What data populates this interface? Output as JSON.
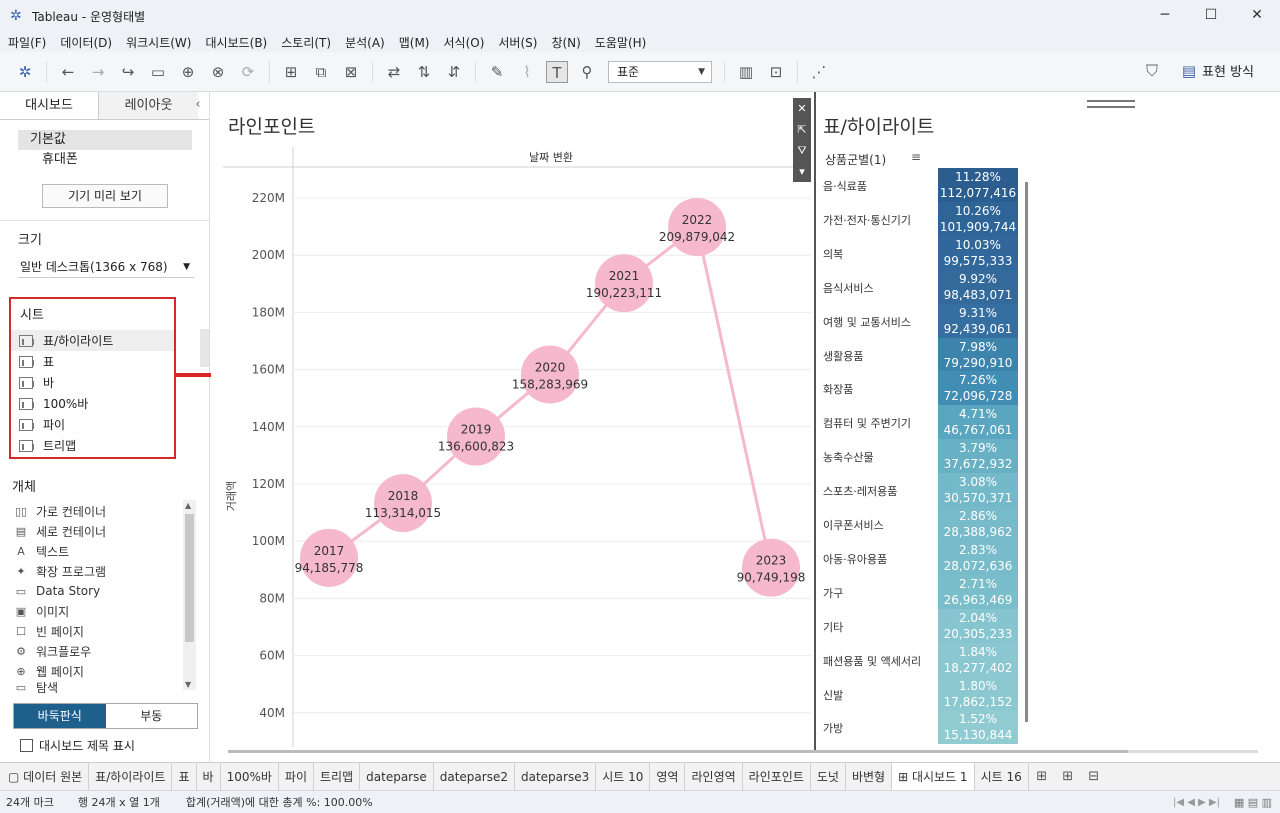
{
  "window": {
    "title": "Tableau - 운영형태별"
  },
  "menu": [
    "파일(F)",
    "데이터(D)",
    "워크시트(W)",
    "대시보드(B)",
    "스토리(T)",
    "분석(A)",
    "맵(M)",
    "서식(O)",
    "서버(S)",
    "창(N)",
    "도움말(H)"
  ],
  "toolbar": {
    "fit_value": "표준",
    "present_label": "표현 방식"
  },
  "left": {
    "tab_dashboard": "대시보드",
    "tab_layout": "레이아웃",
    "device_default": "기본값",
    "device_phone": "휴대폰",
    "device_preview": "기기 미리 보기",
    "size_title": "크기",
    "size_value": "일반 데스크톱(1366 x 768)",
    "sheets_title": "시트",
    "sheets": [
      "표/하이라이트",
      "표",
      "바",
      "100%바",
      "파이",
      "트리맵"
    ],
    "objects_title": "개체",
    "objects": [
      {
        "icon": "horizontal-container-icon",
        "glyph": "▯▯",
        "label": "가로 컨테이너"
      },
      {
        "icon": "vertical-container-icon",
        "glyph": "▤",
        "label": "세로 컨테이너"
      },
      {
        "icon": "text-icon",
        "glyph": "A",
        "label": "텍스트"
      },
      {
        "icon": "extension-icon",
        "glyph": "✦",
        "label": "확장 프로그램"
      },
      {
        "icon": "data-story-icon",
        "glyph": "▭",
        "label": "Data Story"
      },
      {
        "icon": "image-icon",
        "glyph": "▣",
        "label": "이미지"
      },
      {
        "icon": "blank-page-icon",
        "glyph": "☐",
        "label": "빈 페이지"
      },
      {
        "icon": "workflow-icon",
        "glyph": "⚙",
        "label": "워크플로우"
      },
      {
        "icon": "web-page-icon",
        "glyph": "⊕",
        "label": "웹 페이지"
      },
      {
        "icon": "navigation-icon",
        "glyph": "▭",
        "label": "탐색"
      }
    ],
    "layout_tiled": "바둑판식",
    "layout_floating": "부동",
    "show_title": "대시보드 제목 표시"
  },
  "chart": {
    "title": "라인포인트",
    "column_header": "날짜 변환",
    "ylabel": "거래액"
  },
  "chart_data": {
    "type": "line",
    "x": [
      "2017",
      "2018",
      "2019",
      "2020",
      "2021",
      "2022",
      "2023"
    ],
    "values": [
      94185778,
      113314015,
      136600823,
      158283969,
      190223111,
      209879042,
      90749198
    ],
    "labels": [
      "94,185,778",
      "113,314,015",
      "136,600,823",
      "158,283,969",
      "190,223,111",
      "209,879,042",
      "90,749,198"
    ],
    "ylim": [
      40000000,
      220000000
    ],
    "yticks": [
      {
        "v": 220000000,
        "label": "220M"
      },
      {
        "v": 200000000,
        "label": "200M"
      },
      {
        "v": 180000000,
        "label": "180M"
      },
      {
        "v": 160000000,
        "label": "160M"
      },
      {
        "v": 140000000,
        "label": "140M"
      },
      {
        "v": 120000000,
        "label": "120M"
      },
      {
        "v": 100000000,
        "label": "100M"
      },
      {
        "v": 80000000,
        "label": "80M"
      },
      {
        "v": 60000000,
        "label": "60M"
      },
      {
        "v": 40000000,
        "label": "40M"
      }
    ],
    "color": "#f5b8cc"
  },
  "highlight": {
    "title": "표/하이라이트",
    "header": "상품군별(1)",
    "rows": [
      {
        "cat": "음·식료품",
        "pct": "11.28%",
        "val": "112,077,416",
        "color": "#2c5d8f"
      },
      {
        "cat": "가전·전자·통신기기",
        "pct": "10.26%",
        "val": "101,909,744",
        "color": "#2f6496"
      },
      {
        "cat": "의복",
        "pct": "10.03%",
        "val": "99,575,333",
        "color": "#31679a"
      },
      {
        "cat": "음식서비스",
        "pct": "9.92%",
        "val": "98,483,071",
        "color": "#33699b"
      },
      {
        "cat": "여행 및 교통서비스",
        "pct": "9.31%",
        "val": "92,439,061",
        "color": "#356ea0"
      },
      {
        "cat": "생활용품",
        "pct": "7.98%",
        "val": "79,290,910",
        "color": "#3d84ad"
      },
      {
        "cat": "화장품",
        "pct": "7.26%",
        "val": "72,096,728",
        "color": "#418db3"
      },
      {
        "cat": "컴퓨터 및 주변기기",
        "pct": "4.71%",
        "val": "46,767,061",
        "color": "#5aa6c0"
      },
      {
        "cat": "농축수산물",
        "pct": "3.79%",
        "val": "37,672,932",
        "color": "#68b1c5"
      },
      {
        "cat": "스포츠·레저용품",
        "pct": "3.08%",
        "val": "30,570,371",
        "color": "#73b9c9"
      },
      {
        "cat": "이쿠폰서비스",
        "pct": "2.86%",
        "val": "28,388,962",
        "color": "#77bbca"
      },
      {
        "cat": "아동·유아용품",
        "pct": "2.83%",
        "val": "28,072,636",
        "color": "#78bccb"
      },
      {
        "cat": "가구",
        "pct": "2.71%",
        "val": "26,963,469",
        "color": "#7abdcb"
      },
      {
        "cat": "기타",
        "pct": "2.04%",
        "val": "20,305,233",
        "color": "#86c5cf"
      },
      {
        "cat": "패션용품 및 액세서리",
        "pct": "1.84%",
        "val": "18,277,402",
        "color": "#8ac7d0"
      },
      {
        "cat": "신발",
        "pct": "1.80%",
        "val": "17,862,152",
        "color": "#8bc8d0"
      },
      {
        "cat": "가방",
        "pct": "1.52%",
        "val": "15,130,844",
        "color": "#90cbd2"
      }
    ]
  },
  "tabs": {
    "datasource": "데이터 원본",
    "items": [
      "표/하이라이트",
      "표",
      "바",
      "100%바",
      "파이",
      "트리맵",
      "dateparse",
      "dateparse2",
      "dateparse3",
      "시트 10",
      "영역",
      "라인영역",
      "라인포인트",
      "도넛",
      "바변형",
      "대시보드 1",
      "시트 16"
    ],
    "active": "대시보드 1"
  },
  "status": {
    "marks": "24개 마크",
    "rows_cols": "행 24개  x  열 1개",
    "summary": "합계(거래액)에 대한 총계 %: 100.00%"
  }
}
